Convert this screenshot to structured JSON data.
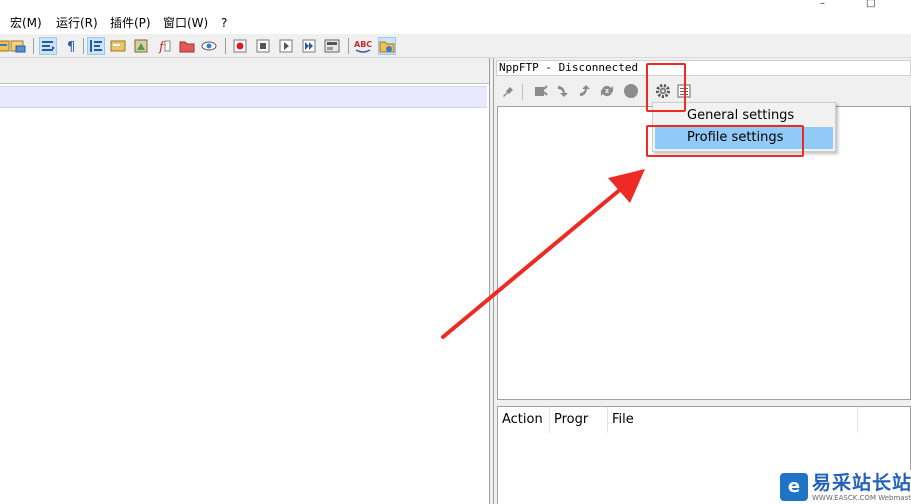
{
  "window": {
    "minimize_glyph": "–",
    "maximize_glyph": "□"
  },
  "menubar": {
    "items": [
      {
        "label": "宏(M)"
      },
      {
        "label": "运行(R)"
      },
      {
        "label": "插件(P)"
      },
      {
        "label": "窗口(W)"
      },
      {
        "label": "?"
      }
    ]
  },
  "toolbar": {
    "icons": [
      "macro-save-icon",
      "find-in-files-icon",
      "word-wrap-icon",
      "show-all-chars-icon",
      "indent-guide-icon",
      "user-lang-icon",
      "document-map-icon",
      "function-list-icon",
      "folder-workspace-icon",
      "monitoring-icon",
      "record-macro-icon",
      "stop-record-icon",
      "play-macro-icon",
      "run-macro-multiple-icon",
      "save-macro-icon",
      "spell-check-icon",
      "nppftp-show-icon"
    ],
    "spellcheck_text": "ABC"
  },
  "nppftp": {
    "title": "NppFTP - Disconnected",
    "toolbar_icons": [
      "connect-icon",
      "disconnect-icon",
      "download-icon",
      "upload-icon",
      "refresh-icon",
      "abort-icon",
      "settings-gear-icon",
      "show-log-icon"
    ],
    "settings_menu": {
      "items": [
        {
          "label": "General settings"
        },
        {
          "label": "Profile settings"
        }
      ],
      "highlighted": "Profile settings"
    },
    "queue_columns": [
      {
        "label": "Action"
      },
      {
        "label": "Progr"
      },
      {
        "label": "File"
      }
    ]
  },
  "annotations": {
    "color": "#ee2a24"
  },
  "watermark": {
    "logo_char": "e",
    "text": "易采站长站",
    "url": "WWW.EASCK.COM Webmaster"
  }
}
